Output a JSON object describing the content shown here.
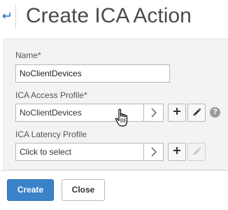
{
  "header": {
    "back_icon": "back-arrow-icon",
    "title": "Create ICA Action"
  },
  "form": {
    "name": {
      "label": "Name*",
      "value": "NoClientDevices"
    },
    "access_profile": {
      "label": "ICA Access Profile*",
      "value": "NoClientDevices",
      "icons": [
        "chevron-right-icon",
        "plus-icon",
        "pencil-icon",
        "help-icon"
      ],
      "help_glyph": "?"
    },
    "latency_profile": {
      "label": "ICA Latency Profile",
      "placeholder": "Click to select",
      "icons": [
        "chevron-right-icon",
        "plus-icon",
        "pencil-icon"
      ]
    }
  },
  "actions": {
    "create_label": "Create",
    "close_label": "Close"
  },
  "colors": {
    "accent": "#3b83c9",
    "back_arrow": "#2a71c2",
    "panel_bg": "#f3f3f3"
  }
}
